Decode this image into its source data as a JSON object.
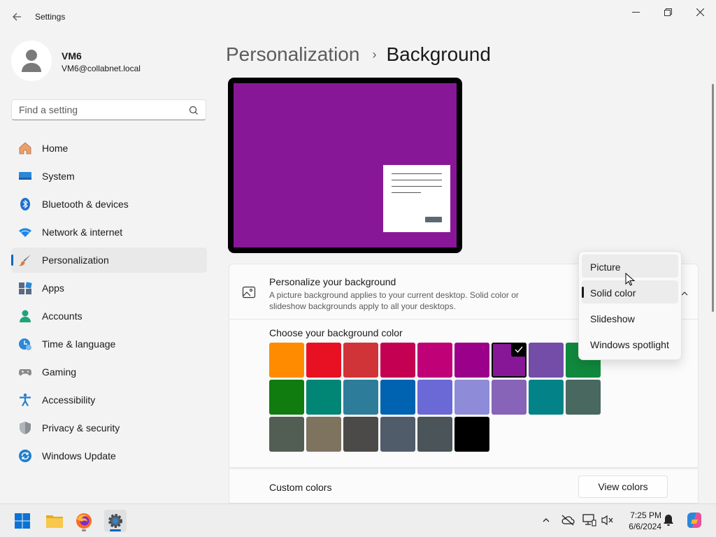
{
  "window": {
    "title": "Settings"
  },
  "user": {
    "name": "VM6",
    "email": "VM6@collabnet.local"
  },
  "search": {
    "placeholder": "Find a setting"
  },
  "nav": {
    "items": [
      {
        "label": "Home",
        "icon": "home-icon"
      },
      {
        "label": "System",
        "icon": "system-icon"
      },
      {
        "label": "Bluetooth & devices",
        "icon": "bluetooth-icon"
      },
      {
        "label": "Network & internet",
        "icon": "wifi-icon"
      },
      {
        "label": "Personalization",
        "icon": "brush-icon",
        "active": true
      },
      {
        "label": "Apps",
        "icon": "apps-icon"
      },
      {
        "label": "Accounts",
        "icon": "accounts-icon"
      },
      {
        "label": "Time & language",
        "icon": "clock-icon"
      },
      {
        "label": "Gaming",
        "icon": "gamepad-icon"
      },
      {
        "label": "Accessibility",
        "icon": "accessibility-icon"
      },
      {
        "label": "Privacy & security",
        "icon": "shield-icon"
      },
      {
        "label": "Windows Update",
        "icon": "update-icon"
      }
    ]
  },
  "breadcrumb": {
    "parent": "Personalization",
    "separator": "›",
    "current": "Background"
  },
  "preview": {
    "background_color": "#881798"
  },
  "background_card": {
    "title": "Personalize your background",
    "description": "A picture background applies to your current desktop. Solid color or slideshow backgrounds apply to all your desktops."
  },
  "dropdown": {
    "options": [
      "Picture",
      "Solid color",
      "Slideshow",
      "Windows spotlight"
    ],
    "selected": "Solid color",
    "hovered": "Picture"
  },
  "colors": {
    "title": "Choose your background color",
    "selected_index": 6,
    "swatches": [
      "#ff8c00",
      "#e81123",
      "#d13438",
      "#c30052",
      "#bf0077",
      "#9a0089",
      "#881798",
      "#744da9",
      "#10893e",
      "#107c10",
      "#018574",
      "#2d7d9a",
      "#0063b1",
      "#6b69d6",
      "#8e8cd8",
      "#8764b8",
      "#038387",
      "#486860",
      "#525e54",
      "#7e735f",
      "#4c4a48",
      "#515c6b",
      "#4a5459",
      "#000000"
    ]
  },
  "custom_colors": {
    "label": "Custom colors",
    "button": "View colors"
  },
  "taskbar": {
    "apps": [
      "windows-start-icon",
      "file-explorer-icon",
      "firefox-icon",
      "settings-icon"
    ],
    "time": "7:25 PM",
    "date": "6/6/2024"
  },
  "accent": "#0067c0"
}
